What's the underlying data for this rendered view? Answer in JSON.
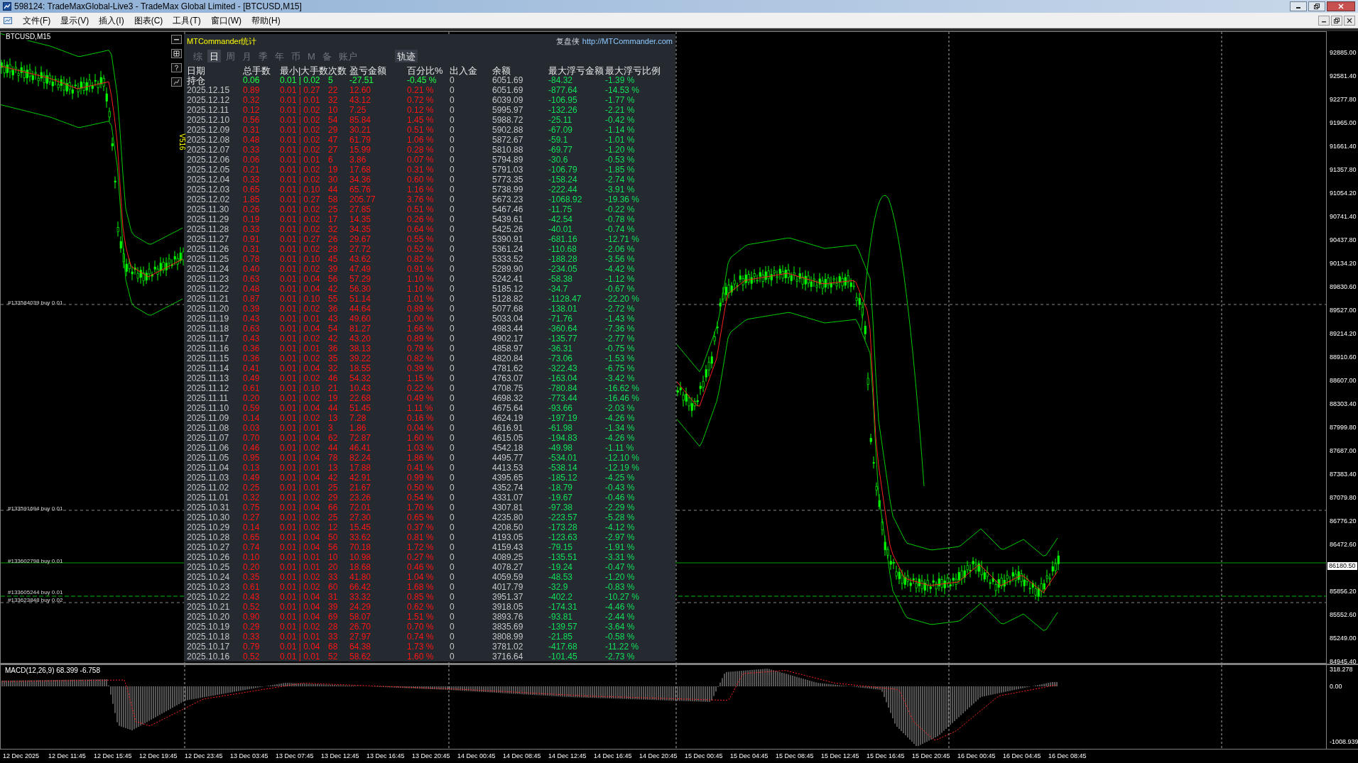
{
  "window": {
    "title": "598124: TradeMaxGlobal-Live3 - TradeMax Global Limited - [BTCUSD,M15]"
  },
  "menu": [
    "文件(F)",
    "显示(V)",
    "插入(I)",
    "图表(C)",
    "工具(T)",
    "窗口(W)",
    "帮助(H)"
  ],
  "chart": {
    "symbol": "BTCUSD,M15",
    "indicator_label": "V516",
    "current_price": "86180.50",
    "price_axis": [
      "92885.00",
      "92581.40",
      "92277.80",
      "91965.00",
      "91661.40",
      "91357.80",
      "91054.20",
      "90741.40",
      "90437.80",
      "90134.20",
      "89830.60",
      "89527.00",
      "89214.20",
      "88910.60",
      "88607.00",
      "88303.40",
      "87999.80",
      "87687.00",
      "87383.40",
      "87079.80",
      "86776.20",
      "86472.60",
      "85856.20",
      "85552.60",
      "85249.00",
      "84945.40"
    ],
    "orders": [
      "#133584039 buy 0.01",
      "#133591694 buy 0.01",
      "#133602798 buy 0.01",
      "#133605244 buy 0.01",
      "#133623848 buy 0.02"
    ]
  },
  "stats_panel": {
    "title": "MTCommander统计",
    "brand": "复盘侠",
    "link": "http://MTCommander.com",
    "tabs": [
      {
        "label": "综",
        "selected": false
      },
      {
        "label": "日",
        "selected": true
      },
      {
        "label": "周",
        "selected": false
      },
      {
        "label": "月",
        "selected": false
      },
      {
        "label": "季",
        "selected": false
      },
      {
        "label": "年",
        "selected": false
      },
      {
        "label": "币",
        "selected": false
      },
      {
        "label": "M",
        "selected": false
      },
      {
        "label": "备",
        "selected": false
      },
      {
        "label": "账户",
        "selected": false
      }
    ],
    "track_button": "轨迹",
    "columns": [
      "日期",
      "总手数",
      "最小|大手数",
      "次数",
      "盈亏金额",
      "百分比%",
      "出入金",
      "余额",
      "最大浮亏金额",
      "最大浮亏比例"
    ],
    "rows": [
      {
        "kind": "open",
        "cells": [
          "持仓",
          "0.06",
          "0.01 | 0.02",
          "5",
          "-27.51",
          "-0.45 %",
          "0",
          "6051.69",
          "-84.32",
          "-1.39 %"
        ]
      },
      {
        "kind": "day",
        "cells": [
          "2025.12.15",
          "0.89",
          "0.01 | 0.27",
          "22",
          "12.60",
          "0.21 %",
          "0",
          "6051.69",
          "-877.64",
          "-14.53 %"
        ]
      },
      {
        "kind": "day",
        "cells": [
          "2025.12.12",
          "0.32",
          "0.01 | 0.01",
          "32",
          "43.12",
          "0.72 %",
          "0",
          "6039.09",
          "-106.95",
          "-1.77 %"
        ]
      },
      {
        "kind": "day",
        "cells": [
          "2025.12.11",
          "0.12",
          "0.01 | 0.02",
          "10",
          "7.25",
          "0.12 %",
          "0",
          "5995.97",
          "-132.26",
          "-2.21 %"
        ]
      },
      {
        "kind": "day",
        "cells": [
          "2025.12.10",
          "0.56",
          "0.01 | 0.02",
          "54",
          "85.84",
          "1.45 %",
          "0",
          "5988.72",
          "-25.11",
          "-0.42 %"
        ]
      },
      {
        "kind": "day",
        "cells": [
          "2025.12.09",
          "0.31",
          "0.01 | 0.02",
          "29",
          "30.21",
          "0.51 %",
          "0",
          "5902.88",
          "-67.09",
          "-1.14 %"
        ]
      },
      {
        "kind": "day",
        "cells": [
          "2025.12.08",
          "0.48",
          "0.01 | 0.02",
          "47",
          "61.79",
          "1.06 %",
          "0",
          "5872.67",
          "-59.1",
          "-1.01 %"
        ]
      },
      {
        "kind": "day",
        "cells": [
          "2025.12.07",
          "0.33",
          "0.01 | 0.02",
          "27",
          "15.99",
          "0.28 %",
          "0",
          "5810.88",
          "-69.77",
          "-1.20 %"
        ]
      },
      {
        "kind": "day",
        "cells": [
          "2025.12.06",
          "0.06",
          "0.01 | 0.01",
          "6",
          "3.86",
          "0.07 %",
          "0",
          "5794.89",
          "-30.6",
          "-0.53 %"
        ]
      },
      {
        "kind": "day",
        "cells": [
          "2025.12.05",
          "0.21",
          "0.01 | 0.02",
          "19",
          "17.68",
          "0.31 %",
          "0",
          "5791.03",
          "-106.79",
          "-1.85 %"
        ]
      },
      {
        "kind": "day",
        "cells": [
          "2025.12.04",
          "0.33",
          "0.01 | 0.02",
          "30",
          "34.36",
          "0.60 %",
          "0",
          "5773.35",
          "-158.24",
          "-2.74 %"
        ]
      },
      {
        "kind": "day",
        "cells": [
          "2025.12.03",
          "0.65",
          "0.01 | 0.10",
          "44",
          "65.76",
          "1.16 %",
          "0",
          "5738.99",
          "-222.44",
          "-3.91 %"
        ]
      },
      {
        "kind": "day",
        "cells": [
          "2025.12.02",
          "1.85",
          "0.01 | 0.27",
          "58",
          "205.77",
          "3.76 %",
          "0",
          "5673.23",
          "-1068.92",
          "-19.36 %"
        ]
      },
      {
        "kind": "day",
        "cells": [
          "2025.11.30",
          "0.26",
          "0.01 | 0.02",
          "25",
          "27.85",
          "0.51 %",
          "0",
          "5467.46",
          "-11.75",
          "-0.22 %"
        ]
      },
      {
        "kind": "day",
        "cells": [
          "2025.11.29",
          "0.19",
          "0.01 | 0.02",
          "17",
          "14.35",
          "0.26 %",
          "0",
          "5439.61",
          "-42.54",
          "-0.78 %"
        ]
      },
      {
        "kind": "day",
        "cells": [
          "2025.11.28",
          "0.33",
          "0.01 | 0.02",
          "32",
          "34.35",
          "0.64 %",
          "0",
          "5425.26",
          "-40.01",
          "-0.74 %"
        ]
      },
      {
        "kind": "day",
        "cells": [
          "2025.11.27",
          "0.91",
          "0.01 | 0.27",
          "26",
          "29.67",
          "0.55 %",
          "0",
          "5390.91",
          "-681.16",
          "-12.71 %"
        ]
      },
      {
        "kind": "day",
        "cells": [
          "2025.11.26",
          "0.31",
          "0.01 | 0.02",
          "28",
          "27.72",
          "0.52 %",
          "0",
          "5361.24",
          "-110.68",
          "-2.06 %"
        ]
      },
      {
        "kind": "day",
        "cells": [
          "2025.11.25",
          "0.78",
          "0.01 | 0.10",
          "45",
          "43.62",
          "0.82 %",
          "0",
          "5333.52",
          "-188.28",
          "-3.56 %"
        ]
      },
      {
        "kind": "day",
        "cells": [
          "2025.11.24",
          "0.40",
          "0.01 | 0.02",
          "39",
          "47.49",
          "0.91 %",
          "0",
          "5289.90",
          "-234.05",
          "-4.42 %"
        ]
      },
      {
        "kind": "day",
        "cells": [
          "2025.11.23",
          "0.63",
          "0.01 | 0.04",
          "56",
          "57.29",
          "1.10 %",
          "0",
          "5242.41",
          "-58.38",
          "-1.12 %"
        ]
      },
      {
        "kind": "day",
        "cells": [
          "2025.11.22",
          "0.48",
          "0.01 | 0.04",
          "42",
          "56.30",
          "1.10 %",
          "0",
          "5185.12",
          "-34.7",
          "-0.67 %"
        ]
      },
      {
        "kind": "day",
        "cells": [
          "2025.11.21",
          "0.87",
          "0.01 | 0.10",
          "55",
          "51.14",
          "1.01 %",
          "0",
          "5128.82",
          "-1128.47",
          "-22.20 %"
        ]
      },
      {
        "kind": "day",
        "cells": [
          "2025.11.20",
          "0.39",
          "0.01 | 0.02",
          "36",
          "44.64",
          "0.89 %",
          "0",
          "5077.68",
          "-138.01",
          "-2.72 %"
        ]
      },
      {
        "kind": "day",
        "cells": [
          "2025.11.19",
          "0.43",
          "0.01 | 0.01",
          "43",
          "49.60",
          "1.00 %",
          "0",
          "5033.04",
          "-71.76",
          "-1.43 %"
        ]
      },
      {
        "kind": "day",
        "cells": [
          "2025.11.18",
          "0.63",
          "0.01 | 0.04",
          "54",
          "81.27",
          "1.66 %",
          "0",
          "4983.44",
          "-360.64",
          "-7.36 %"
        ]
      },
      {
        "kind": "day",
        "cells": [
          "2025.11.17",
          "0.43",
          "0.01 | 0.02",
          "42",
          "43.20",
          "0.89 %",
          "0",
          "4902.17",
          "-135.77",
          "-2.77 %"
        ]
      },
      {
        "kind": "day",
        "cells": [
          "2025.11.16",
          "0.36",
          "0.01 | 0.01",
          "36",
          "38.13",
          "0.79 %",
          "0",
          "4858.97",
          "-36.31",
          "-0.75 %"
        ]
      },
      {
        "kind": "day",
        "cells": [
          "2025.11.15",
          "0.36",
          "0.01 | 0.02",
          "35",
          "39.22",
          "0.82 %",
          "0",
          "4820.84",
          "-73.06",
          "-1.53 %"
        ]
      },
      {
        "kind": "day",
        "cells": [
          "2025.11.14",
          "0.41",
          "0.01 | 0.04",
          "32",
          "18.55",
          "0.39 %",
          "0",
          "4781.62",
          "-322.43",
          "-6.75 %"
        ]
      },
      {
        "kind": "day",
        "cells": [
          "2025.11.13",
          "0.49",
          "0.01 | 0.02",
          "46",
          "54.32",
          "1.15 %",
          "0",
          "4763.07",
          "-163.04",
          "-3.42 %"
        ]
      },
      {
        "kind": "day",
        "cells": [
          "2025.11.12",
          "0.61",
          "0.01 | 0.10",
          "21",
          "10.43",
          "0.22 %",
          "0",
          "4708.75",
          "-780.84",
          "-16.62 %"
        ]
      },
      {
        "kind": "day",
        "cells": [
          "2025.11.11",
          "0.20",
          "0.01 | 0.02",
          "19",
          "22.68",
          "0.49 %",
          "0",
          "4698.32",
          "-773.44",
          "-16.46 %"
        ]
      },
      {
        "kind": "day",
        "cells": [
          "2025.11.10",
          "0.59",
          "0.01 | 0.04",
          "44",
          "51.45",
          "1.11 %",
          "0",
          "4675.64",
          "-93.66",
          "-2.03 %"
        ]
      },
      {
        "kind": "day",
        "cells": [
          "2025.11.09",
          "0.14",
          "0.01 | 0.02",
          "13",
          "7.28",
          "0.16 %",
          "0",
          "4624.19",
          "-197.19",
          "-4.26 %"
        ]
      },
      {
        "kind": "day",
        "cells": [
          "2025.11.08",
          "0.03",
          "0.01 | 0.01",
          "3",
          "1.86",
          "0.04 %",
          "0",
          "4616.91",
          "-61.98",
          "-1.34 %"
        ]
      },
      {
        "kind": "day",
        "cells": [
          "2025.11.07",
          "0.70",
          "0.01 | 0.04",
          "62",
          "72.87",
          "1.60 %",
          "0",
          "4615.05",
          "-194.83",
          "-4.26 %"
        ]
      },
      {
        "kind": "day",
        "cells": [
          "2025.11.06",
          "0.46",
          "0.01 | 0.02",
          "44",
          "46.41",
          "1.03 %",
          "0",
          "4542.18",
          "-49.98",
          "-1.11 %"
        ]
      },
      {
        "kind": "day",
        "cells": [
          "2025.11.05",
          "0.95",
          "0.01 | 0.04",
          "78",
          "82.24",
          "1.86 %",
          "0",
          "4495.77",
          "-534.01",
          "-12.10 %"
        ]
      },
      {
        "kind": "day",
        "cells": [
          "2025.11.04",
          "0.13",
          "0.01 | 0.01",
          "13",
          "17.88",
          "0.41 %",
          "0",
          "4413.53",
          "-538.14",
          "-12.19 %"
        ]
      },
      {
        "kind": "day",
        "cells": [
          "2025.11.03",
          "0.49",
          "0.01 | 0.04",
          "42",
          "42.91",
          "0.99 %",
          "0",
          "4395.65",
          "-185.12",
          "-4.25 %"
        ]
      },
      {
        "kind": "day",
        "cells": [
          "2025.11.02",
          "0.25",
          "0.01 | 0.01",
          "25",
          "21.67",
          "0.50 %",
          "0",
          "4352.74",
          "-18.79",
          "-0.43 %"
        ]
      },
      {
        "kind": "day",
        "cells": [
          "2025.11.01",
          "0.32",
          "0.01 | 0.02",
          "29",
          "23.26",
          "0.54 %",
          "0",
          "4331.07",
          "-19.67",
          "-0.46 %"
        ]
      },
      {
        "kind": "day",
        "cells": [
          "2025.10.31",
          "0.75",
          "0.01 | 0.04",
          "66",
          "72.01",
          "1.70 %",
          "0",
          "4307.81",
          "-97.38",
          "-2.29 %"
        ]
      },
      {
        "kind": "day",
        "cells": [
          "2025.10.30",
          "0.27",
          "0.01 | 0.02",
          "25",
          "27.30",
          "0.65 %",
          "0",
          "4235.80",
          "-223.57",
          "-5.28 %"
        ]
      },
      {
        "kind": "day",
        "cells": [
          "2025.10.29",
          "0.14",
          "0.01 | 0.02",
          "12",
          "15.45",
          "0.37 %",
          "0",
          "4208.50",
          "-173.28",
          "-4.12 %"
        ]
      },
      {
        "kind": "day",
        "cells": [
          "2025.10.28",
          "0.65",
          "0.01 | 0.04",
          "50",
          "33.62",
          "0.81 %",
          "0",
          "4193.05",
          "-123.63",
          "-2.97 %"
        ]
      },
      {
        "kind": "day",
        "cells": [
          "2025.10.27",
          "0.74",
          "0.01 | 0.04",
          "56",
          "70.18",
          "1.72 %",
          "0",
          "4159.43",
          "-79.15",
          "-1.91 %"
        ]
      },
      {
        "kind": "day",
        "cells": [
          "2025.10.26",
          "0.10",
          "0.01 | 0.01",
          "10",
          "10.98",
          "0.27 %",
          "0",
          "4089.25",
          "-135.51",
          "-3.31 %"
        ]
      },
      {
        "kind": "day",
        "cells": [
          "2025.10.25",
          "0.20",
          "0.01 | 0.01",
          "20",
          "18.68",
          "0.46 %",
          "0",
          "4078.27",
          "-19.24",
          "-0.47 %"
        ]
      },
      {
        "kind": "day",
        "cells": [
          "2025.10.24",
          "0.35",
          "0.01 | 0.02",
          "33",
          "41.80",
          "1.04 %",
          "0",
          "4059.59",
          "-48.53",
          "-1.20 %"
        ]
      },
      {
        "kind": "day",
        "cells": [
          "2025.10.23",
          "0.61",
          "0.01 | 0.02",
          "60",
          "66.42",
          "1.68 %",
          "0",
          "4017.79",
          "-32.9",
          "-0.83 %"
        ]
      },
      {
        "kind": "day",
        "cells": [
          "2025.10.22",
          "0.43",
          "0.01 | 0.04",
          "31",
          "33.32",
          "0.85 %",
          "0",
          "3951.37",
          "-402.2",
          "-10.27 %"
        ]
      },
      {
        "kind": "day",
        "cells": [
          "2025.10.21",
          "0.52",
          "0.01 | 0.04",
          "39",
          "24.29",
          "0.62 %",
          "0",
          "3918.05",
          "-174.31",
          "-4.46 %"
        ]
      },
      {
        "kind": "day",
        "cells": [
          "2025.10.20",
          "0.90",
          "0.01 | 0.04",
          "69",
          "58.07",
          "1.51 %",
          "0",
          "3893.76",
          "-93.81",
          "-2.44 %"
        ]
      },
      {
        "kind": "day",
        "cells": [
          "2025.10.19",
          "0.29",
          "0.01 | 0.02",
          "28",
          "26.70",
          "0.70 %",
          "0",
          "3835.69",
          "-139.57",
          "-3.64 %"
        ]
      },
      {
        "kind": "day",
        "cells": [
          "2025.10.18",
          "0.33",
          "0.01 | 0.01",
          "33",
          "27.97",
          "0.74 %",
          "0",
          "3808.99",
          "-21.85",
          "-0.58 %"
        ]
      },
      {
        "kind": "day",
        "cells": [
          "2025.10.17",
          "0.79",
          "0.01 | 0.04",
          "68",
          "64.38",
          "1.73 %",
          "0",
          "3781.02",
          "-417.68",
          "-11.22 %"
        ]
      },
      {
        "kind": "day",
        "cells": [
          "2025.10.16",
          "0.52",
          "0.01 | 0.01",
          "52",
          "58.62",
          "1.60 %",
          "0",
          "3716.64",
          "-101.45",
          "-2.73 %"
        ]
      }
    ]
  },
  "macd": {
    "label": "MACD(12,26,9) 68.399 -6.758",
    "axis": [
      "318.278",
      "0.00",
      "-1008.939"
    ]
  },
  "time_axis": [
    "12 Dec 2025",
    "12 Dec 11:45",
    "12 Dec 15:45",
    "12 Dec 19:45",
    "12 Dec 23:45",
    "13 Dec 03:45",
    "13 Dec 07:45",
    "13 Dec 12:45",
    "13 Dec 16:45",
    "13 Dec 20:45",
    "14 Dec 00:45",
    "14 Dec 08:45",
    "14 Dec 12:45",
    "14 Dec 16:45",
    "14 Dec 20:45",
    "15 Dec 00:45",
    "15 Dec 04:45",
    "15 Dec 08:45",
    "15 Dec 12:45",
    "15 Dec 16:45",
    "15 Dec 20:45",
    "16 Dec 00:45",
    "16 Dec 04:45",
    "16 Dec 08:45"
  ]
}
